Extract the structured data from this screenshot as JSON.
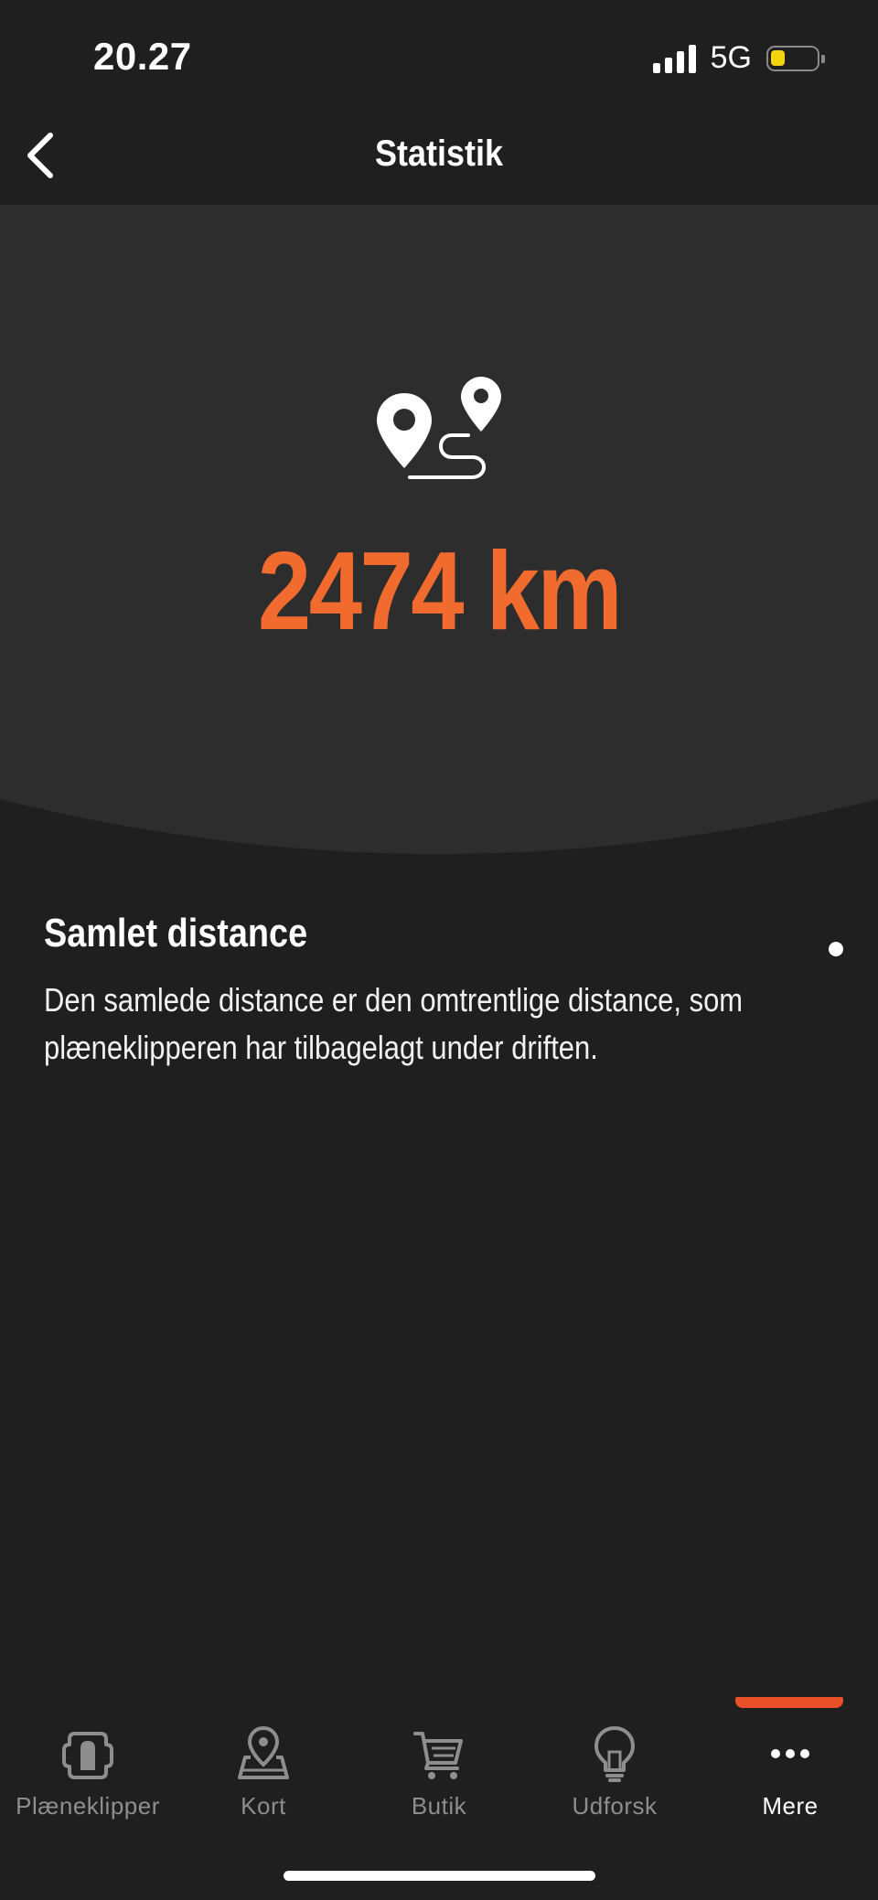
{
  "status_bar": {
    "time": "20.27",
    "network": "5G",
    "battery_color": "#f5d30d"
  },
  "header": {
    "title": "Statistik",
    "back_icon": "chevron-left-icon"
  },
  "hero": {
    "icon": "route-icon",
    "value": "2474 km",
    "accent_color": "#f26b2e"
  },
  "info": {
    "title": "Samlet distance",
    "description": "Den samlede distance er den omtrentlige distance, som plæneklipperen har tilbagelagt under driften."
  },
  "tab_bar": {
    "active_tab": "Mere",
    "tabs": [
      {
        "label": "Plæneklipper",
        "icon": "mower-icon"
      },
      {
        "label": "Kort",
        "icon": "map-icon"
      },
      {
        "label": "Butik",
        "icon": "cart-icon"
      },
      {
        "label": "Udforsk",
        "icon": "lightbulb-icon"
      },
      {
        "label": "Mere",
        "icon": "more-icon"
      }
    ]
  }
}
